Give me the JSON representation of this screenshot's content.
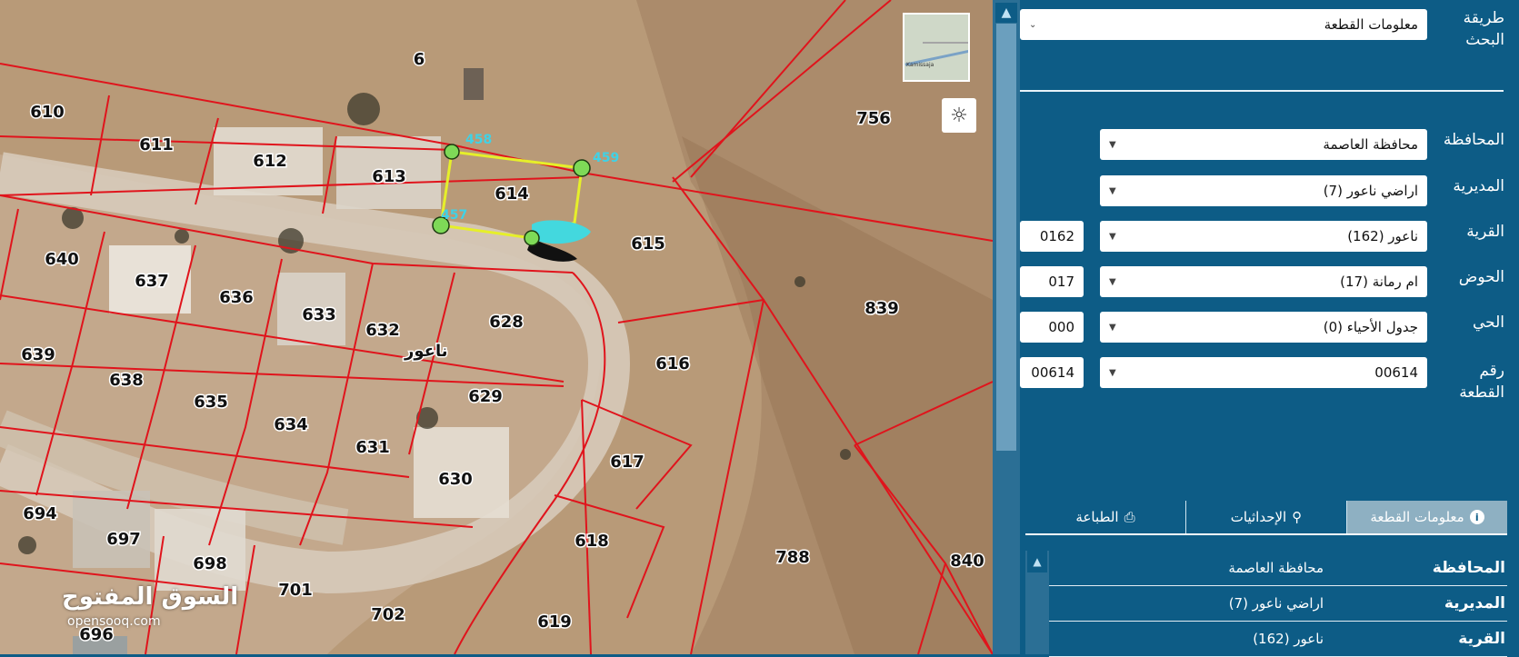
{
  "map": {
    "parcels": [
      "610",
      "611",
      "612",
      "613",
      "614",
      "615",
      "616",
      "617",
      "618",
      "619",
      "628",
      "629",
      "630",
      "631",
      "632",
      "633",
      "634",
      "635",
      "636",
      "637",
      "638",
      "639",
      "640",
      "694",
      "696",
      "697",
      "698",
      "701",
      "702",
      "756",
      "788",
      "839",
      "840",
      "6"
    ],
    "vertex_labels": [
      "458",
      "459",
      "457"
    ],
    "area_name": "ناعور",
    "watermark": "السوق المفتوح",
    "watermark_sub": "opensooq.com",
    "minimap_caption": "Kamissaja"
  },
  "panel": {
    "search_method_label": "طريقة البحث",
    "search_method_value": "معلومات القطعة",
    "governorate_label": "المحافظة",
    "governorate_value": "محافظة العاصمة",
    "directorate_label": "المديرية",
    "directorate_value": "اراضي ناعور (7)",
    "village_label": "القرية",
    "village_value": "ناعور (162)",
    "village_code": "0162",
    "basin_label": "الحوض",
    "basin_value": "ام رمانة (17)",
    "basin_code": "017",
    "neighborhood_label": "الحي",
    "neighborhood_value": "جدول الأحياء (0)",
    "neighborhood_code": "000",
    "parcel_number_label": "رقم القطعة",
    "parcel_number_value": "00614",
    "parcel_number_code": "00614"
  },
  "tabs": [
    {
      "label": "معلومات القطعة",
      "icon": "info-icon",
      "active": true
    },
    {
      "label": "الإحداثيات",
      "icon": "location-pin-icon",
      "active": false
    },
    {
      "label": "الطباعة",
      "icon": "printer-icon",
      "active": false
    }
  ],
  "info_rows": [
    {
      "key": "المحافظة",
      "value": "محافظة العاصمة"
    },
    {
      "key": "المديرية",
      "value": "اراضي ناعور (7)"
    },
    {
      "key": "القرية",
      "value": "ناعور (162)"
    }
  ],
  "colors": {
    "panel_bg": "#0d5c86",
    "parcel_lines": "#e0141c",
    "selected_outline": "#e6ef2a",
    "vertex": "#7ed957"
  }
}
